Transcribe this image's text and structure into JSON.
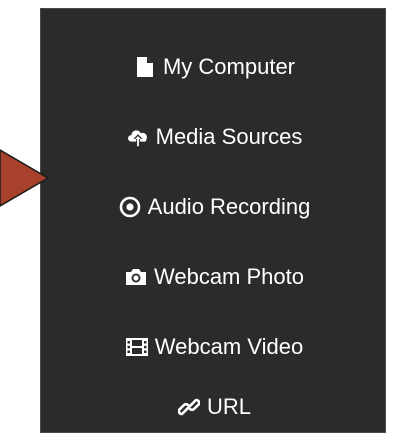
{
  "menu": {
    "items": [
      {
        "label": "My Computer",
        "icon": "file-icon"
      },
      {
        "label": "Media Sources",
        "icon": "cloud-upload-icon"
      },
      {
        "label": "Audio Recording",
        "icon": "record-icon"
      },
      {
        "label": "Webcam Photo",
        "icon": "camera-icon"
      },
      {
        "label": "Webcam Video",
        "icon": "film-icon"
      },
      {
        "label": "URL",
        "icon": "link-icon"
      }
    ]
  },
  "colors": {
    "panel_background": "#2b2b2b",
    "text": "#ffffff",
    "pointer_arrow": "#a8412b"
  }
}
